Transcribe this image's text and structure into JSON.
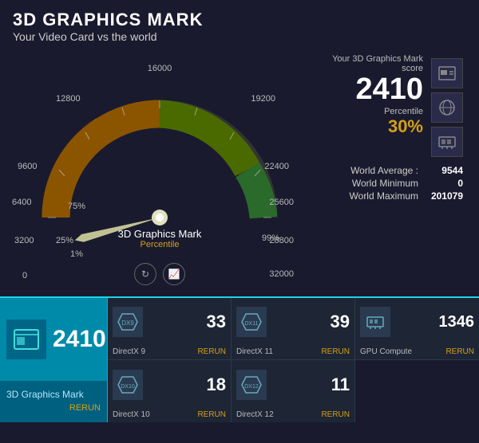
{
  "header": {
    "title": "3D GRAPHICS MARK",
    "subtitle": "Your Video Card vs the world"
  },
  "gauge": {
    "labels_left": [
      "9600",
      "6400",
      "3200",
      "0"
    ],
    "labels_right": [
      "22400",
      "25600",
      "28800",
      "32000"
    ],
    "label_top": "16000",
    "label_top_left": "12800",
    "label_top_right": "19200",
    "label_bottom_left": "0",
    "label_bottom_right": "32000",
    "pct_75": "75%",
    "pct_25": "25%",
    "pct_1": "1%",
    "pct_99": "99%",
    "center_label": "3D Graphics Mark",
    "percentile_label": "Percentile",
    "footer_icons": [
      "clock",
      "chart"
    ]
  },
  "score": {
    "label": "Your 3D Graphics Mark score",
    "value": "2410",
    "percentile_title": "Percentile",
    "percentile_value": "30%",
    "world_average_label": "World Average :",
    "world_average_value": "9544",
    "world_minimum_label": "World Minimum",
    "world_minimum_value": "0",
    "world_maximum_label": "World Maximum",
    "world_maximum_value": "201079"
  },
  "main_tile": {
    "score": "2410",
    "label": "3D Graphics Mark",
    "rerun": "RERUN"
  },
  "sub_tiles": [
    {
      "score": "33",
      "label": "DirectX 9",
      "rerun": "RERUN",
      "icon": "dx9"
    },
    {
      "score": "39",
      "label": "DirectX 11",
      "rerun": "RERUN",
      "icon": "dx11"
    },
    {
      "score": "1346",
      "label": "GPU Compute",
      "rerun": "RERUN",
      "icon": "gpu"
    },
    {
      "score": "18",
      "label": "DirectX 10",
      "rerun": "RERUN",
      "icon": "dx10"
    },
    {
      "score": "11",
      "label": "DirectX 12",
      "rerun": "RERUN",
      "icon": "dx12"
    }
  ]
}
